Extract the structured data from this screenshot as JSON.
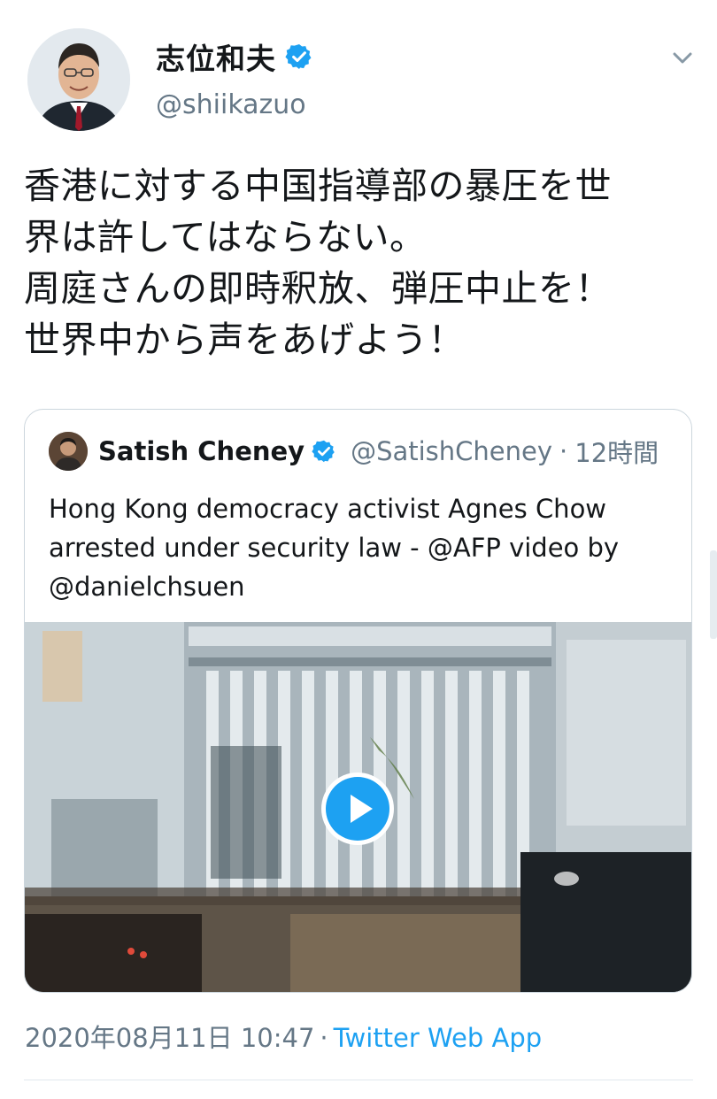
{
  "author": {
    "display_name": "志位和夫",
    "handle": "@shiikazuo",
    "verified": true,
    "avatar_icon": "person-avatar"
  },
  "tweet": {
    "lines": [
      "香港に対する中国指導部の暴圧を世",
      "界は許してはならない。",
      "周庭さんの即時釈放、弾圧中止を！",
      "世界中から声をあげよう！"
    ]
  },
  "quoted": {
    "display_name": "Satish Cheney",
    "verified": true,
    "handle": "@SatishCheney",
    "dot": "·",
    "time": "12時間",
    "text_lines": [
      "Hong Kong democracy activist Agnes Chow",
      "arrested under security law - @AFP  video by",
      "@danielchsuen"
    ],
    "media": {
      "type": "video",
      "play_icon": "play-icon"
    }
  },
  "meta": {
    "date": "2020年08月11日 10:47",
    "separator": "·",
    "source": "Twitter Web App"
  },
  "colors": {
    "accent": "#1da1f2",
    "secondary_text": "#657786",
    "border": "#ccd6dd"
  }
}
